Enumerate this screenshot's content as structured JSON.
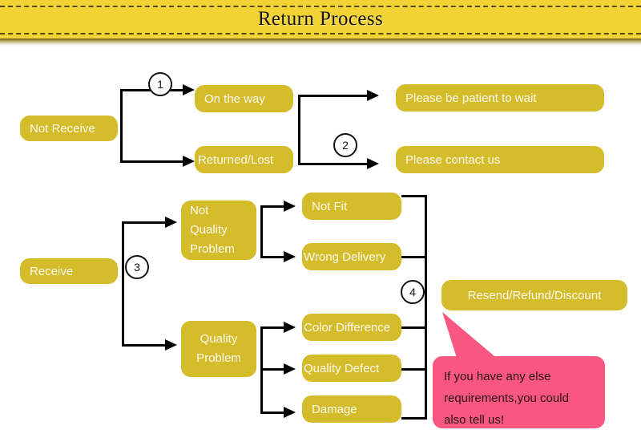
{
  "header": {
    "title": "Return Process",
    "bar_color": "#f2d335",
    "dash_color": "#5c4608"
  },
  "theme": {
    "node_fill": "#d4bc2b",
    "node_text": "#fdf9ef",
    "line_color": "#000000",
    "callout_fill": "#f9577f",
    "callout_text": "#2a1118",
    "page_background": "#ffffff"
  },
  "steps": [
    {
      "label": "1"
    },
    {
      "label": "2"
    },
    {
      "label": "3"
    },
    {
      "label": "4"
    }
  ],
  "nodes": {
    "not_receive": "Not Receive",
    "on_the_way": "On the way",
    "returned_lost": "Returned/Lost",
    "please_wait": "Please be patient to wait",
    "please_contact": "Please contact us",
    "receive": "Receive",
    "not_quality_problem": "Not Quality Problem",
    "quality_problem": "Quality Problem",
    "not_fit": "Not Fit",
    "wrong_delivery": "Wrong Delivery",
    "color_difference": "Color Difference",
    "quality_defect": "Quality Defect",
    "damage": "Damage",
    "resend_refund_discount": "Resend/Refund/Discount"
  },
  "callout": {
    "text": "If you have any else requirements,you could also tell us!"
  }
}
